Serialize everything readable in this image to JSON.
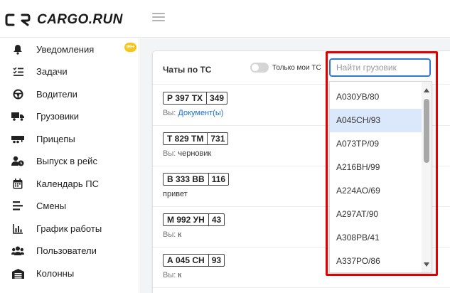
{
  "app": {
    "logo_text": "CARGO.RUN"
  },
  "sidebar": {
    "items": [
      {
        "label": "Уведомления",
        "icon": "bell-icon",
        "badge": "99+"
      },
      {
        "label": "Задачи",
        "icon": "tasks-list-icon"
      },
      {
        "label": "Водители",
        "icon": "steering-wheel-icon"
      },
      {
        "label": "Грузовики",
        "icon": "truck-icon"
      },
      {
        "label": "Прицепы",
        "icon": "trailer-icon"
      },
      {
        "label": "Выпуск в рейс",
        "icon": "person-clock-icon"
      },
      {
        "label": "Календарь ПС",
        "icon": "calendar-icon"
      },
      {
        "label": "Смены",
        "icon": "shifts-lines-icon"
      },
      {
        "label": "График работы",
        "icon": "bar-chart-icon"
      },
      {
        "label": "Пользователи",
        "icon": "users-icon"
      },
      {
        "label": "Колонны",
        "icon": "warehouse-icon"
      }
    ]
  },
  "chats": {
    "title": "Чаты по ТС",
    "toggle_label": "Только мои ТС",
    "rows": [
      {
        "plate": "Р 397 ТХ",
        "region": "349",
        "prefix": "Вы:",
        "message": "Документ(ы)",
        "is_link": true
      },
      {
        "plate": "Т 829 ТМ",
        "region": "731",
        "prefix": "Вы:",
        "message": "черновик",
        "is_link": false
      },
      {
        "plate": "В 333 ВВ",
        "region": "116",
        "prefix": "",
        "message": "привет",
        "is_link": false
      },
      {
        "plate": "М 992 УН",
        "region": "43",
        "prefix": "Вы:",
        "message": "к",
        "is_link": false
      },
      {
        "plate": "А 045 СН",
        "region": "93",
        "prefix": "Вы:",
        "message": "к",
        "is_link": false
      }
    ]
  },
  "search": {
    "placeholder": "Найти грузовик",
    "value": "",
    "options": [
      "А030УВ/80",
      "А045СН/93",
      "А073ТР/09",
      "А216ВН/99",
      "А224АО/69",
      "А297АТ/90",
      "А308РВ/41",
      "А337РО/86"
    ],
    "selected": "А045СН/93"
  },
  "colors": {
    "accent_blue": "#2f79d6",
    "highlight_red": "#e00000",
    "badge_yellow": "#f5c518",
    "selected_bg": "#dbe8fb"
  }
}
